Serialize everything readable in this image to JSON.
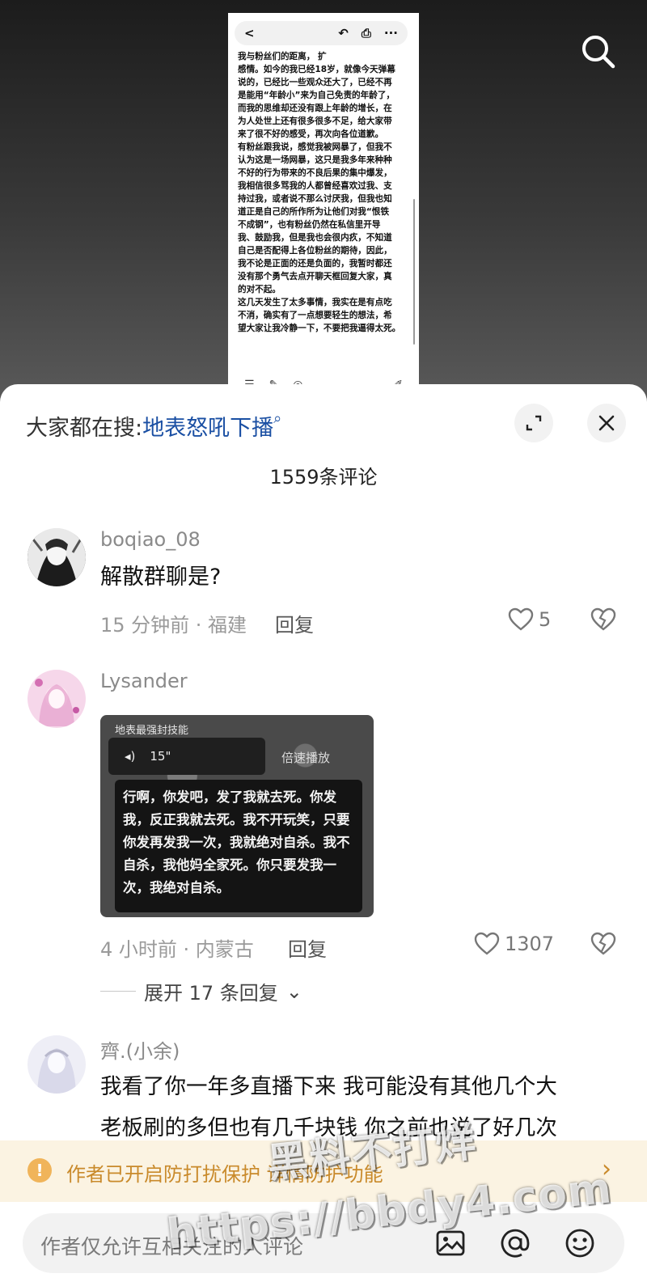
{
  "video": {
    "toolbar": {
      "back": "<",
      "undo": "↶",
      "share": "⎙",
      "more": "···"
    },
    "post_text": [
      "我与粉丝们的距离，   扩",
      "感情。如今的我已经18岁，就像今天弹幕",
      "说的，已经比一些观众还大了，已经不再",
      "是能用“年龄小”来为自己免责的年龄了，",
      "而我的思维却还没有跟上年龄的增长，在",
      "为人处世上还有很多很多不足，给大家带",
      "来了很不好的感受，再次向各位道歉。",
      "有粉丝跟我说，感觉我被网暴了，但我不",
      "认为这是一场网暴，这只是我多年来种种",
      "不好的行为带来的不良后果的集中爆发，",
      "我相信很多骂我的人都曾经喜欢过我、支",
      "持过我，或者说不那么讨厌我，但我也知",
      "道正是自己的所作所为让他们对我“恨铁",
      "不成钢”，也有粉丝仍然在私信里开导",
      "我、鼓励我，但是我也会很内疚，不知道",
      "自己是否配得上各位粉丝的期待，因此，",
      "我不论是正面的还是负面的，我暂时都还",
      "没有那个勇气去点开聊天框回复大家，真",
      "的对不起。",
      "这几天发生了太多事情，我实在是有点吃",
      "不消，确实有了一点想要轻生的想法，希",
      "望大家让我冷静一下，不要把我逼得太死。"
    ]
  },
  "header": {
    "trending_prefix": "大家都在搜:",
    "trending_keyword": "地表怒吼下播",
    "comment_count": "1559条评论"
  },
  "comments": [
    {
      "username": "boqiao_08",
      "text": "解散群聊是?",
      "time_location": "15 分钟前 · 福建",
      "reply_label": "回复",
      "likes": "5"
    },
    {
      "username": "Lysander",
      "image": {
        "title": "地表最强封技能",
        "voice_duration": "15\"",
        "speed_label": "倍速播放",
        "quote": "行啊，你发吧，发了我就去死。你发我，反正我就去死。我不开玩笑，只要你发再发我一次，我就绝对自杀。我不自杀，我他妈全家死。你只要发我一次，我绝对自杀。"
      },
      "time_location": "4 小时前 · 内蒙古",
      "reply_label": "回复",
      "likes": "1307",
      "expand_replies": "展开 17 条回复"
    },
    {
      "username": "齊.(小余)",
      "text_line1": "我看了你一年多直播下来 我可能没有其他几个大",
      "text_line2": "老板刷的多但也有几千块钱 你之前也说了好几次"
    }
  ],
  "notice": {
    "text": "作者已开启防打扰保护      详情防护功能"
  },
  "input": {
    "placeholder": "作者仅允许互相关注的人评论"
  },
  "watermark": {
    "line1": "黑料不打烊",
    "line2": "https://bbdy4.com"
  },
  "colors": {
    "link_blue": "#1a4fa3",
    "notice_bg": "#fbf3e2",
    "notice_text": "#c98a2b"
  }
}
